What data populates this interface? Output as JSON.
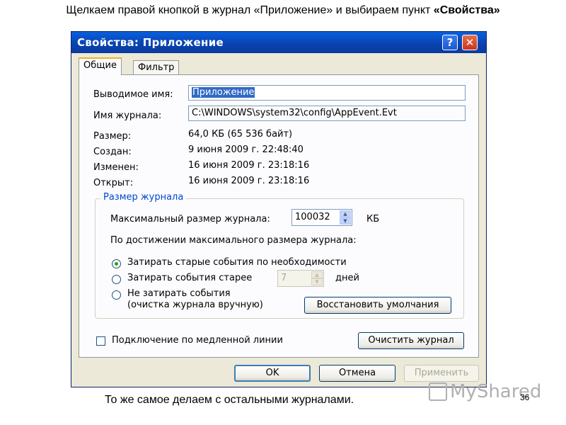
{
  "captions": {
    "top_prefix": "Щелкаем правой кнопкой в журнал «Приложение» и выбираем пункт ",
    "top_bold": "«Свойства»",
    "bottom": "То же самое делаем с остальными журналами.",
    "watermark": "MyShared",
    "slide_number": "36"
  },
  "dialog": {
    "title": "Свойства: Приложение",
    "help_glyph": "?",
    "close_glyph": "✕",
    "tabs": [
      "Общие",
      "Фильтр"
    ],
    "general": {
      "display_name_label": "Выводимое имя:",
      "display_name_value": "Приложение",
      "log_name_label": "Имя журнала:",
      "log_name_value": "C:\\WINDOWS\\system32\\config\\AppEvent.Evt",
      "size_label": "Размер:",
      "size_value": "64,0 КБ (65 536 байт)",
      "created_label": "Создан:",
      "created_value": "9 июня 2009 г. 22:48:40",
      "modified_label": "Изменен:",
      "modified_value": "16 июня 2009 г. 23:18:16",
      "opened_label": "Открыт:",
      "opened_value": "16 июня 2009 г. 23:18:16"
    },
    "log_size": {
      "group_title": "Размер журнала",
      "max_size_label": "Максимальный размер журнала:",
      "max_size_value": "100032",
      "max_size_unit": "КБ",
      "on_max_label": "По достижении максимального размера журнала:",
      "options": [
        {
          "label": "Затирать старые события по необходимости",
          "selected": true
        },
        {
          "label": "Затирать события старее",
          "selected": false
        },
        {
          "label": "Не затирать события",
          "selected": false
        }
      ],
      "days_value": "7",
      "days_unit": "дней",
      "option3_sub": "(очистка журнала вручную)",
      "restore_defaults": "Восстановить умолчания"
    },
    "slow_link_label": "Подключение по медленной линии",
    "slow_link_checked": false,
    "clear_log": "Очистить журнал",
    "buttons": {
      "ok": "OK",
      "cancel": "Отмена",
      "apply": "Применить"
    }
  }
}
